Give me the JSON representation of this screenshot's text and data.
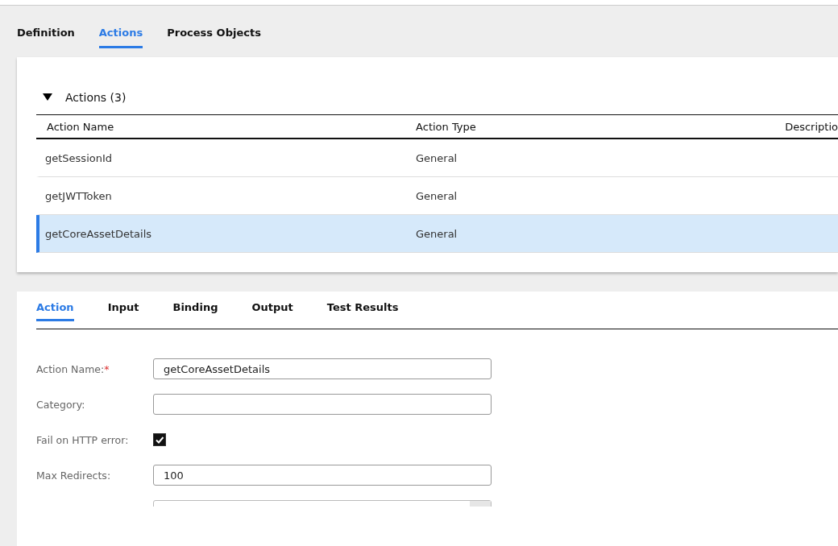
{
  "tabs": [
    {
      "label": "Definition",
      "selected": false
    },
    {
      "label": "Actions",
      "selected": true
    },
    {
      "label": "Process Objects",
      "selected": false
    }
  ],
  "actions": {
    "title": "Actions (3)",
    "expanded": true,
    "columns": [
      "Action Name",
      "Action Type",
      "Descriptio"
    ],
    "rows": [
      {
        "cells": [
          "getSessionId",
          "General"
        ],
        "selected": false
      },
      {
        "cells": [
          "getJWTToken",
          "General"
        ],
        "selected": false
      },
      {
        "cells": [
          "getCoreAssetDetails",
          "General"
        ],
        "selected": true
      }
    ]
  },
  "detail_tabs": [
    {
      "label": "Action",
      "selected": true
    },
    {
      "label": "Input",
      "selected": false
    },
    {
      "label": "Binding",
      "selected": false
    },
    {
      "label": "Output",
      "selected": false
    },
    {
      "label": "Test Results",
      "selected": false
    }
  ],
  "form": [
    {
      "kind": "text",
      "label": "Action Name:",
      "required_mark": "*",
      "value": "getCoreAssetDetails"
    },
    {
      "kind": "text",
      "label": "Category:"
    },
    {
      "kind": "checkbox",
      "label": "Fail on HTTP error:",
      "checked": true
    },
    {
      "kind": "text",
      "label": "Max Redirects:",
      "value": "100"
    },
    {
      "kind": "select"
    }
  ]
}
